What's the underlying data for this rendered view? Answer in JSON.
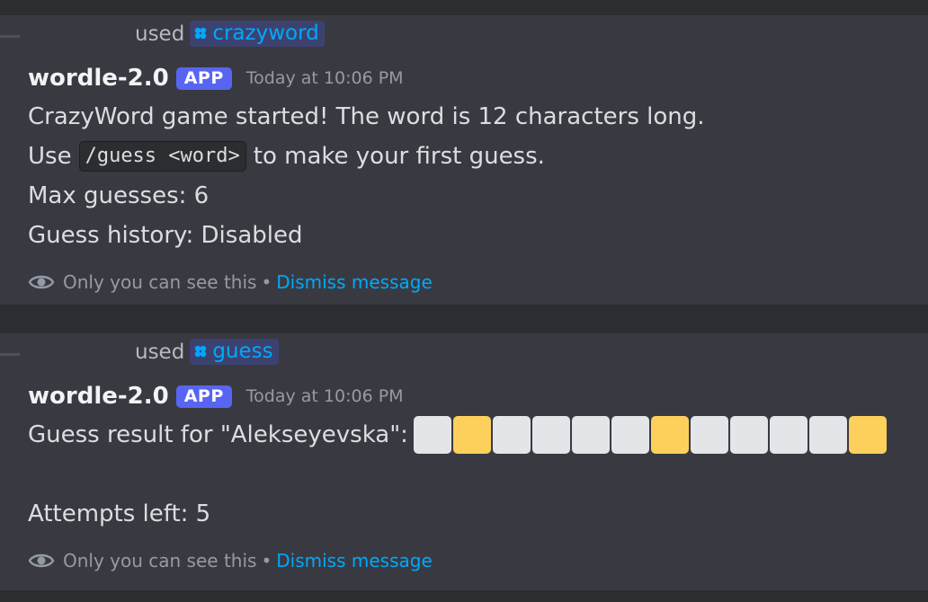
{
  "messages": [
    {
      "used_word": "used",
      "command": "crazyword",
      "author": "wordle-2.0",
      "badge": "APP",
      "timestamp": "Today at 10:06 PM",
      "line1": "CrazyWord game started! The word is 12 characters long.",
      "line2_pre": "Use",
      "line2_code": "/guess <word>",
      "line2_post": "to make your first guess.",
      "line3": "Max guesses: 6",
      "line4": "Guess history: Disabled",
      "ephemeral_note": "Only you can see this",
      "separator": "•",
      "dismiss": "Dismiss message"
    },
    {
      "used_word": "used",
      "command": "guess",
      "author": "wordle-2.0",
      "badge": "APP",
      "timestamp": "Today at 10:06 PM",
      "result_label": "Guess result for \"Alekseyevska\":",
      "tiles": [
        "gray",
        "yellow",
        "gray",
        "gray",
        "gray",
        "gray",
        "yellow",
        "gray",
        "gray",
        "gray",
        "gray",
        "yellow"
      ],
      "attempts": "Attempts left: 5",
      "ephemeral_note": "Only you can see this",
      "separator": "•",
      "dismiss": "Dismiss message"
    }
  ],
  "colors": {
    "tile_gray": "#e3e5e8",
    "tile_yellow": "#fdd05c",
    "link": "#00a8fc",
    "app_badge": "#5865f2"
  }
}
